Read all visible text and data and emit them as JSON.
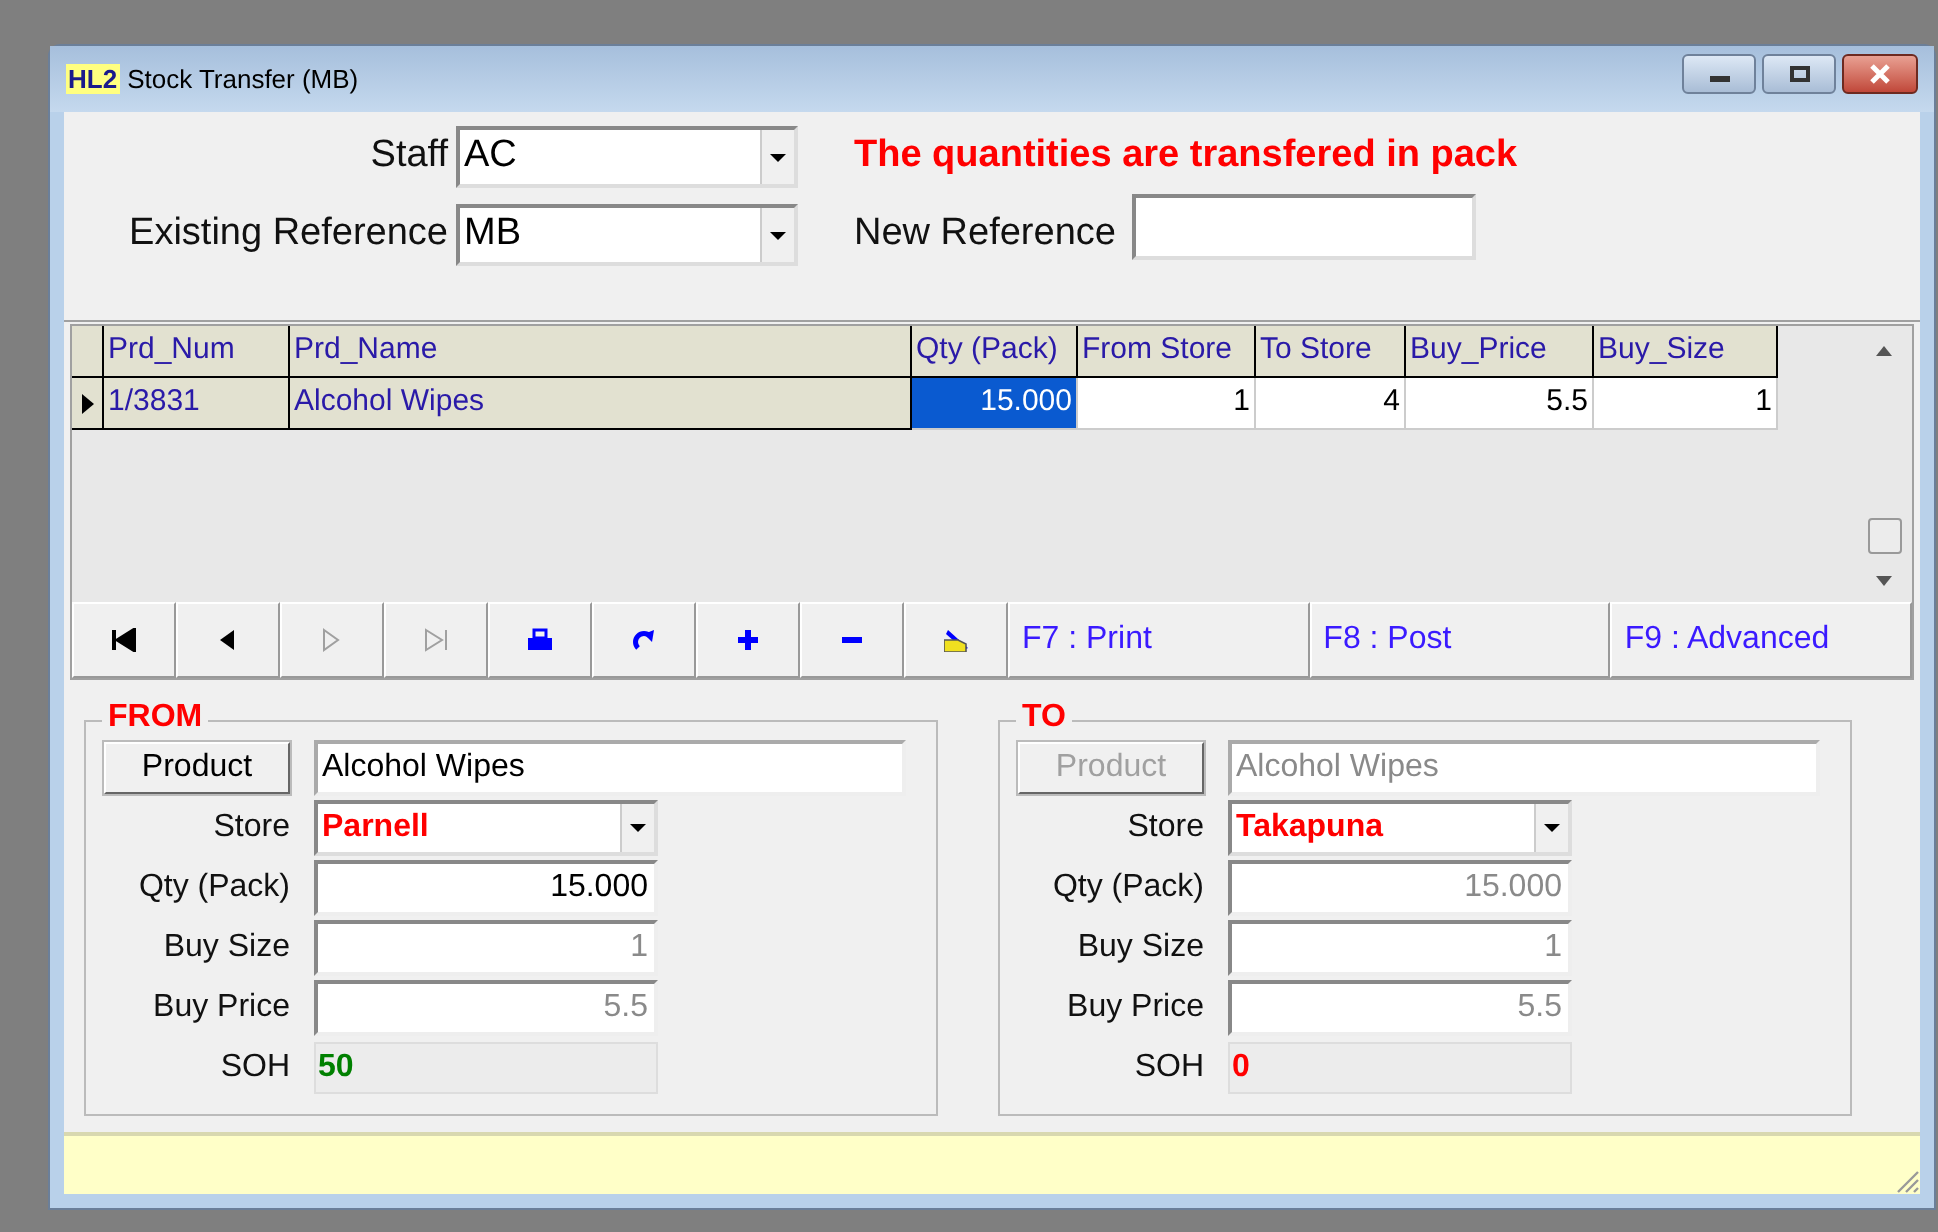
{
  "window": {
    "title": "Stock Transfer (MB)",
    "app_badge": "HL2"
  },
  "header": {
    "staff": {
      "label": "Staff",
      "value": "AC"
    },
    "notice": "The quantities are transfered in pack",
    "existing_reference": {
      "label": "Existing Reference",
      "value": "MB"
    },
    "new_reference": {
      "label": "New Reference"
    }
  },
  "grid": {
    "columns": [
      "Prd_Num",
      "Prd_Name",
      "Qty (Pack)",
      "From Store",
      "To Store",
      "Buy_Price",
      "Buy_Size"
    ],
    "rows": [
      {
        "current": true,
        "cells": [
          {
            "text": "1/3831",
            "readonly": true,
            "focused": false
          },
          {
            "text": "Alcohol Wipes",
            "readonly": true,
            "focused": false
          },
          {
            "text": "15.000",
            "readonly": false,
            "focused": true
          },
          {
            "text": "1",
            "readonly": false,
            "focused": false
          },
          {
            "text": "4",
            "readonly": false,
            "focused": false
          },
          {
            "text": "5.5",
            "readonly": false,
            "focused": false
          },
          {
            "text": "1",
            "readonly": false,
            "focused": false
          }
        ]
      }
    ]
  },
  "navigator": {
    "buttons": [
      {
        "kind": "first",
        "disabled": false
      },
      {
        "kind": "prev",
        "disabled": false
      },
      {
        "kind": "next",
        "disabled": true
      },
      {
        "kind": "last",
        "disabled": true
      },
      {
        "kind": "print",
        "disabled": false
      },
      {
        "kind": "refresh",
        "disabled": false
      },
      {
        "kind": "add",
        "disabled": false
      },
      {
        "kind": "delete",
        "disabled": false
      },
      {
        "kind": "edit",
        "disabled": false
      }
    ],
    "keys": [
      "F7 : Print",
      "F8 : Post",
      "F9 : Advanced"
    ]
  },
  "panels": [
    {
      "title": "FROM",
      "product_button": {
        "label": "Product",
        "disabled": false
      },
      "product_value": "Alcohol Wipes",
      "product_disabled": false,
      "fields": [
        {
          "kind": "dropdown",
          "label": "Store",
          "value": "Parnell",
          "disabled": false
        },
        {
          "kind": "number",
          "label": "Qty (Pack)",
          "value": "15.000",
          "disabled": false
        },
        {
          "kind": "number",
          "label": "Buy Size",
          "value": "1",
          "disabled": true
        },
        {
          "kind": "number",
          "label": "Buy Price",
          "value": "5.5",
          "disabled": true
        },
        {
          "kind": "static",
          "label": "SOH",
          "value": "50",
          "color": "#008000"
        }
      ]
    },
    {
      "title": "TO",
      "product_button": {
        "label": "Product",
        "disabled": true
      },
      "product_value": "Alcohol Wipes",
      "product_disabled": true,
      "fields": [
        {
          "kind": "dropdown",
          "label": "Store",
          "value": "Takapuna",
          "disabled": false
        },
        {
          "kind": "number",
          "label": "Qty (Pack)",
          "value": "15.000",
          "disabled": true
        },
        {
          "kind": "number",
          "label": "Buy Size",
          "value": "1",
          "disabled": true
        },
        {
          "kind": "number",
          "label": "Buy Price",
          "value": "5.5",
          "disabled": true
        },
        {
          "kind": "static",
          "label": "SOH",
          "value": "0",
          "color": "#ff0000"
        }
      ]
    }
  ]
}
